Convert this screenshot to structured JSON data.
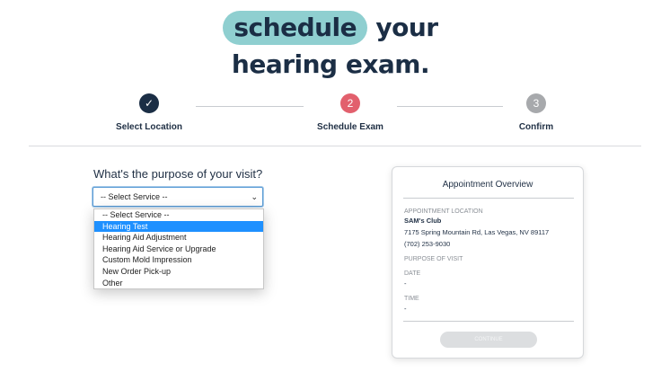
{
  "hero": {
    "highlight": "schedule",
    "line1_rest": " your",
    "line2": "hearing exam."
  },
  "steps": [
    {
      "label": "Select Location",
      "marker": "✓",
      "state": "done"
    },
    {
      "label": "Schedule Exam",
      "marker": "2",
      "state": "active"
    },
    {
      "label": "Confirm",
      "marker": "3",
      "state": "todo"
    }
  ],
  "form": {
    "question": "What's the purpose of your visit?",
    "select_value": "-- Select Service --",
    "options": [
      "-- Select Service --",
      "Hearing Test",
      "Hearing Aid Adjustment",
      "Hearing Aid Service or Upgrade",
      "Custom Mold Impression",
      "New Order Pick-up",
      "Other"
    ],
    "highlighted_option": "Hearing Test"
  },
  "overview": {
    "title": "Appointment Overview",
    "location_label": "APPOINTMENT LOCATION",
    "location_name": "SAM's Club",
    "address": "7175 Spring Mountain Rd, Las Vegas, NV 89117",
    "phone": "(702) 253-9030",
    "purpose_label": "PURPOSE OF VISIT",
    "date_label": "DATE",
    "date_value": "-",
    "time_label": "TIME",
    "time_value": "-",
    "cta": "CONTINUE"
  },
  "colors": {
    "navy": "#1b2e45",
    "teal": "#8fcfd0",
    "active_step": "#e2606d",
    "pending_step": "#a7a9ac",
    "highlight": "#1e90ff"
  }
}
